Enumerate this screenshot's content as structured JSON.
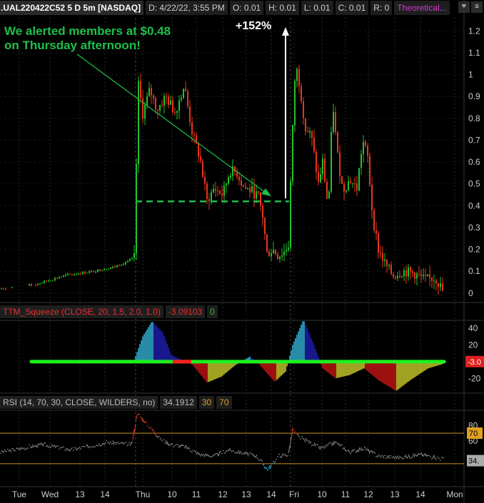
{
  "header": {
    "symbol": ".UAL220422C52 5 D 5m [NASDAQ]",
    "date": "D: 4/22/22, 3:55 PM",
    "open": "O: 0.01",
    "high": "H: 0.01",
    "low": "L: 0.01",
    "close": "C: 0.01",
    "range": "R: 0",
    "theoretical": "Theoretical..."
  },
  "annotation": {
    "line1": "We alerted members at $0.48",
    "line2": "on Thursday afternoon!",
    "gain": "+152%"
  },
  "ttm": {
    "title": "TTM_Squeeze (CLOSE, 20, 1.5, 2.0, 1.0)",
    "value": "-3.09103",
    "squeeze": "0",
    "axis_ticks": [
      "40",
      "20",
      "-20"
    ],
    "current": "-3.0"
  },
  "rsi": {
    "title": "RSI (14, 70, 30, CLOSE, WILDERS, no)",
    "value": "34.1912",
    "over_sold": "30",
    "over_bought": "70",
    "axis_ticks": [
      "80",
      "60"
    ],
    "current": "34."
  },
  "price_axis": [
    "1.2",
    "1.1",
    "1",
    "0.9",
    "0.8",
    "0.7",
    "0.6",
    "0.5",
    "0.4",
    "0.3",
    "0.2",
    "0.1",
    "0"
  ],
  "time_axis": [
    "Tue",
    "Wed",
    "13",
    "14",
    "Thu",
    "10",
    "11",
    "12",
    "13",
    "14",
    "Fri",
    "10",
    "11",
    "12",
    "13",
    "14",
    "Mon"
  ],
  "colors": {
    "up": "#22c12b",
    "down": "#e8361c",
    "annotation": "#1fbf4b",
    "theoretical": "#d63cd6"
  },
  "chart_data": {
    "type": "candlestick",
    "ylim": [
      -0.03,
      1.26
    ],
    "alert_price": 0.42,
    "gain_label": "+152%",
    "ttm_ylim": [
      -35,
      50
    ],
    "rsi_ylim": [
      0,
      100
    ],
    "rsi_levels": [
      30,
      70
    ]
  }
}
